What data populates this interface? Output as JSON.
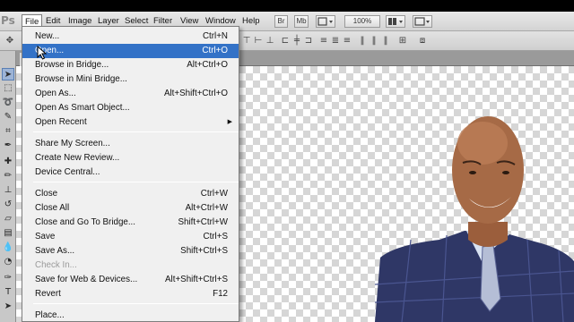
{
  "menubar": {
    "logo": "Ps",
    "items": [
      "File",
      "Edit",
      "Image",
      "Layer",
      "Select",
      "Filter",
      "View",
      "Window",
      "Help"
    ],
    "active_index": 0,
    "bridge_btn": "Br",
    "minibridge_btn": "Mb",
    "zoom": "100%"
  },
  "file_menu": {
    "items": [
      {
        "label": "New...",
        "shortcut": "Ctrl+N"
      },
      {
        "label": "Open...",
        "shortcut": "Ctrl+O",
        "highlighted": true
      },
      {
        "label": "Browse in Bridge...",
        "shortcut": "Alt+Ctrl+O"
      },
      {
        "label": "Browse in Mini Bridge...",
        "shortcut": ""
      },
      {
        "label": "Open As...",
        "shortcut": "Alt+Shift+Ctrl+O"
      },
      {
        "label": "Open As Smart Object...",
        "shortcut": ""
      },
      {
        "label": "Open Recent",
        "shortcut": "",
        "submenu": true
      },
      {
        "label": "Share My Screen...",
        "shortcut": ""
      },
      {
        "label": "Create New Review...",
        "shortcut": ""
      },
      {
        "label": "Device Central...",
        "shortcut": ""
      },
      {
        "label": "Close",
        "shortcut": "Ctrl+W"
      },
      {
        "label": "Close All",
        "shortcut": "Alt+Ctrl+W"
      },
      {
        "label": "Close and Go To Bridge...",
        "shortcut": "Shift+Ctrl+W"
      },
      {
        "label": "Save",
        "shortcut": "Ctrl+S"
      },
      {
        "label": "Save As...",
        "shortcut": "Shift+Ctrl+S"
      },
      {
        "label": "Check In...",
        "shortcut": "",
        "disabled": true
      },
      {
        "label": "Save for Web & Devices...",
        "shortcut": "Alt+Shift+Ctrl+S"
      },
      {
        "label": "Revert",
        "shortcut": "F12"
      },
      {
        "label": "Place...",
        "shortcut": ""
      }
    ]
  },
  "icons": {
    "submenu": "submenu-arrow-icon",
    "cursor": "arrow-cursor-icon"
  },
  "colors": {
    "highlight": "#3372c7",
    "menu_bg": "#f0f0f0",
    "suit": "#2f3766"
  }
}
